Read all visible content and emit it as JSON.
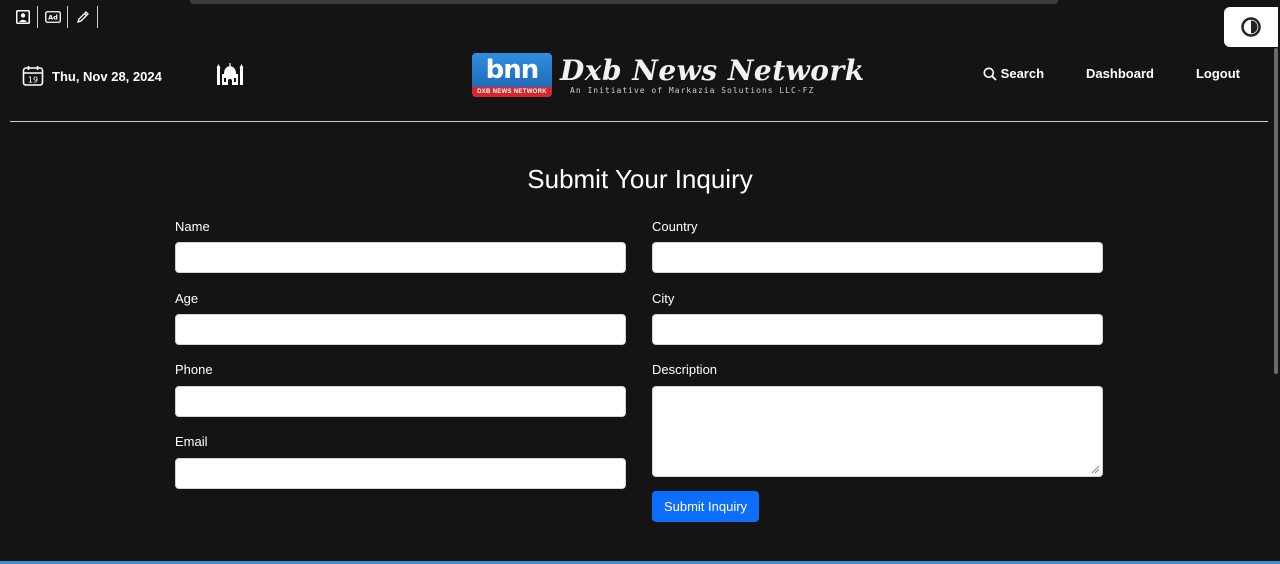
{
  "toolbar": {
    "icons": [
      "profile-icon",
      "ad-icon",
      "pencil-icon"
    ]
  },
  "header": {
    "date": "Thu, Nov 28, 2024",
    "calendar_day": "19",
    "logo": {
      "badge_text": "bnn",
      "badge_strip": "DXB NEWS NETWORK",
      "title": "Dxb News Network",
      "subtitle": "An Initiative of Markazia Solutions LLC-FZ"
    },
    "nav": {
      "search": "Search",
      "dashboard": "Dashboard",
      "logout": "Logout"
    }
  },
  "form": {
    "title": "Submit Your Inquiry",
    "fields": {
      "name": {
        "label": "Name",
        "value": ""
      },
      "age": {
        "label": "Age",
        "value": ""
      },
      "phone": {
        "label": "Phone",
        "value": ""
      },
      "email": {
        "label": "Email",
        "value": ""
      },
      "country": {
        "label": "Country",
        "value": ""
      },
      "city": {
        "label": "City",
        "value": ""
      },
      "description": {
        "label": "Description",
        "value": ""
      }
    },
    "submit_label": "Submit Inquiry"
  },
  "colors": {
    "background": "#141414",
    "accent": "#0d6efd",
    "logo_blue": "#2f8fe0",
    "logo_red": "#d7262d"
  }
}
